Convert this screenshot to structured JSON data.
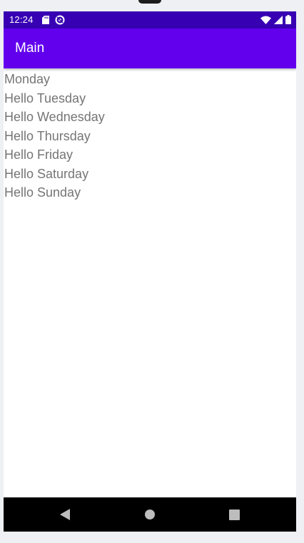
{
  "status_bar": {
    "time": "12:24",
    "left_icons": [
      "sd-card-icon",
      "sync-icon"
    ],
    "right_icons": [
      "wifi-icon",
      "cell-signal-icon",
      "battery-icon"
    ]
  },
  "app_bar": {
    "title": "Main"
  },
  "list": {
    "items": [
      "Monday",
      "Hello Tuesday",
      "Hello Wednesday",
      "Hello Thursday",
      "Hello Friday",
      "Hello Saturday",
      "Hello Sunday"
    ]
  },
  "nav_bar": {
    "buttons": [
      "back-icon",
      "home-icon",
      "recents-icon"
    ]
  },
  "colors": {
    "status_bar": "#3700b3",
    "app_bar": "#6200ee",
    "list_text": "#757575",
    "nav_bar": "#000000"
  }
}
